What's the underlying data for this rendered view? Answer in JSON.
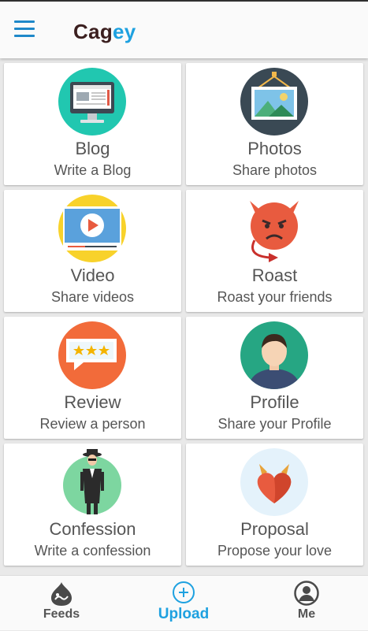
{
  "app": {
    "brand_prefix": "Cag",
    "brand_suffix": "ey"
  },
  "cards": [
    {
      "title": "Blog",
      "subtitle": "Write a Blog"
    },
    {
      "title": "Photos",
      "subtitle": "Share photos"
    },
    {
      "title": "Video",
      "subtitle": "Share videos"
    },
    {
      "title": "Roast",
      "subtitle": "Roast your friends"
    },
    {
      "title": "Review",
      "subtitle": "Review a person"
    },
    {
      "title": "Profile",
      "subtitle": "Share your Profile"
    },
    {
      "title": "Confession",
      "subtitle": "Write a confession"
    },
    {
      "title": "Proposal",
      "subtitle": "Propose your love"
    }
  ],
  "bottom_nav": {
    "feeds": "Feeds",
    "upload": "Upload",
    "me": "Me",
    "active": "Upload"
  },
  "colors": {
    "accent": "#1ea1e0",
    "menu": "#1e88c9",
    "text": "#555555"
  }
}
